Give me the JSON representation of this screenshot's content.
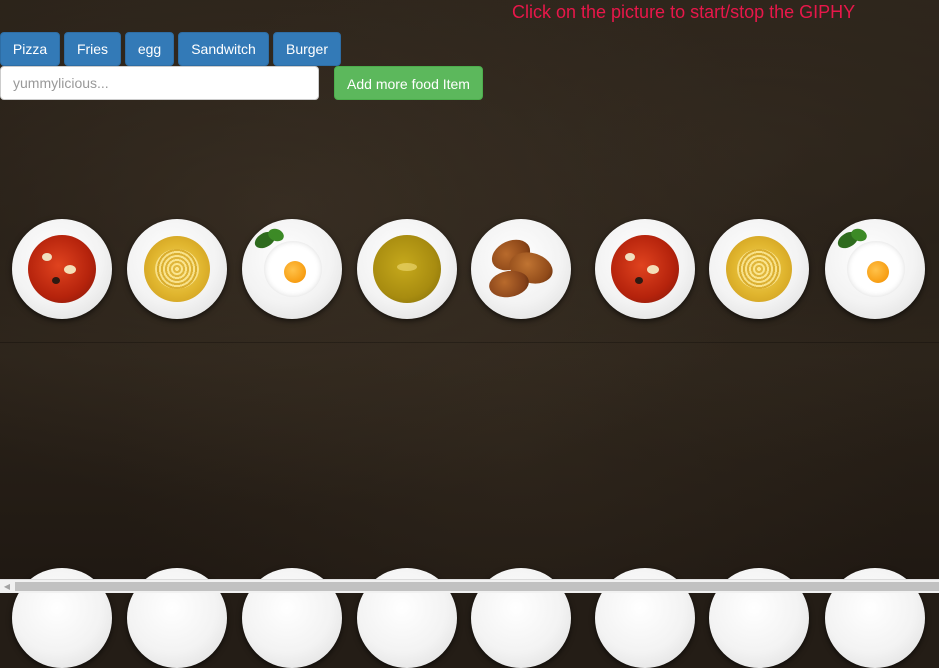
{
  "header": {
    "instruction": "Click on the picture to start/stop the GIPHY"
  },
  "food_buttons": [
    "Pizza",
    "Fries",
    "egg",
    "Sandwitch",
    "Burger"
  ],
  "form": {
    "input_value": "",
    "input_placeholder": "yummylicious...",
    "add_button_label": "Add more food Item"
  },
  "plates_row1": [
    "tomato-stew",
    "pasta",
    "fried-egg",
    "green-soup",
    "croissants",
    "tomato-stew",
    "pasta",
    "fried-egg"
  ],
  "colors": {
    "instruction": "#e8174a",
    "primary_button": "#337ab7",
    "success_button": "#5cb85c"
  }
}
